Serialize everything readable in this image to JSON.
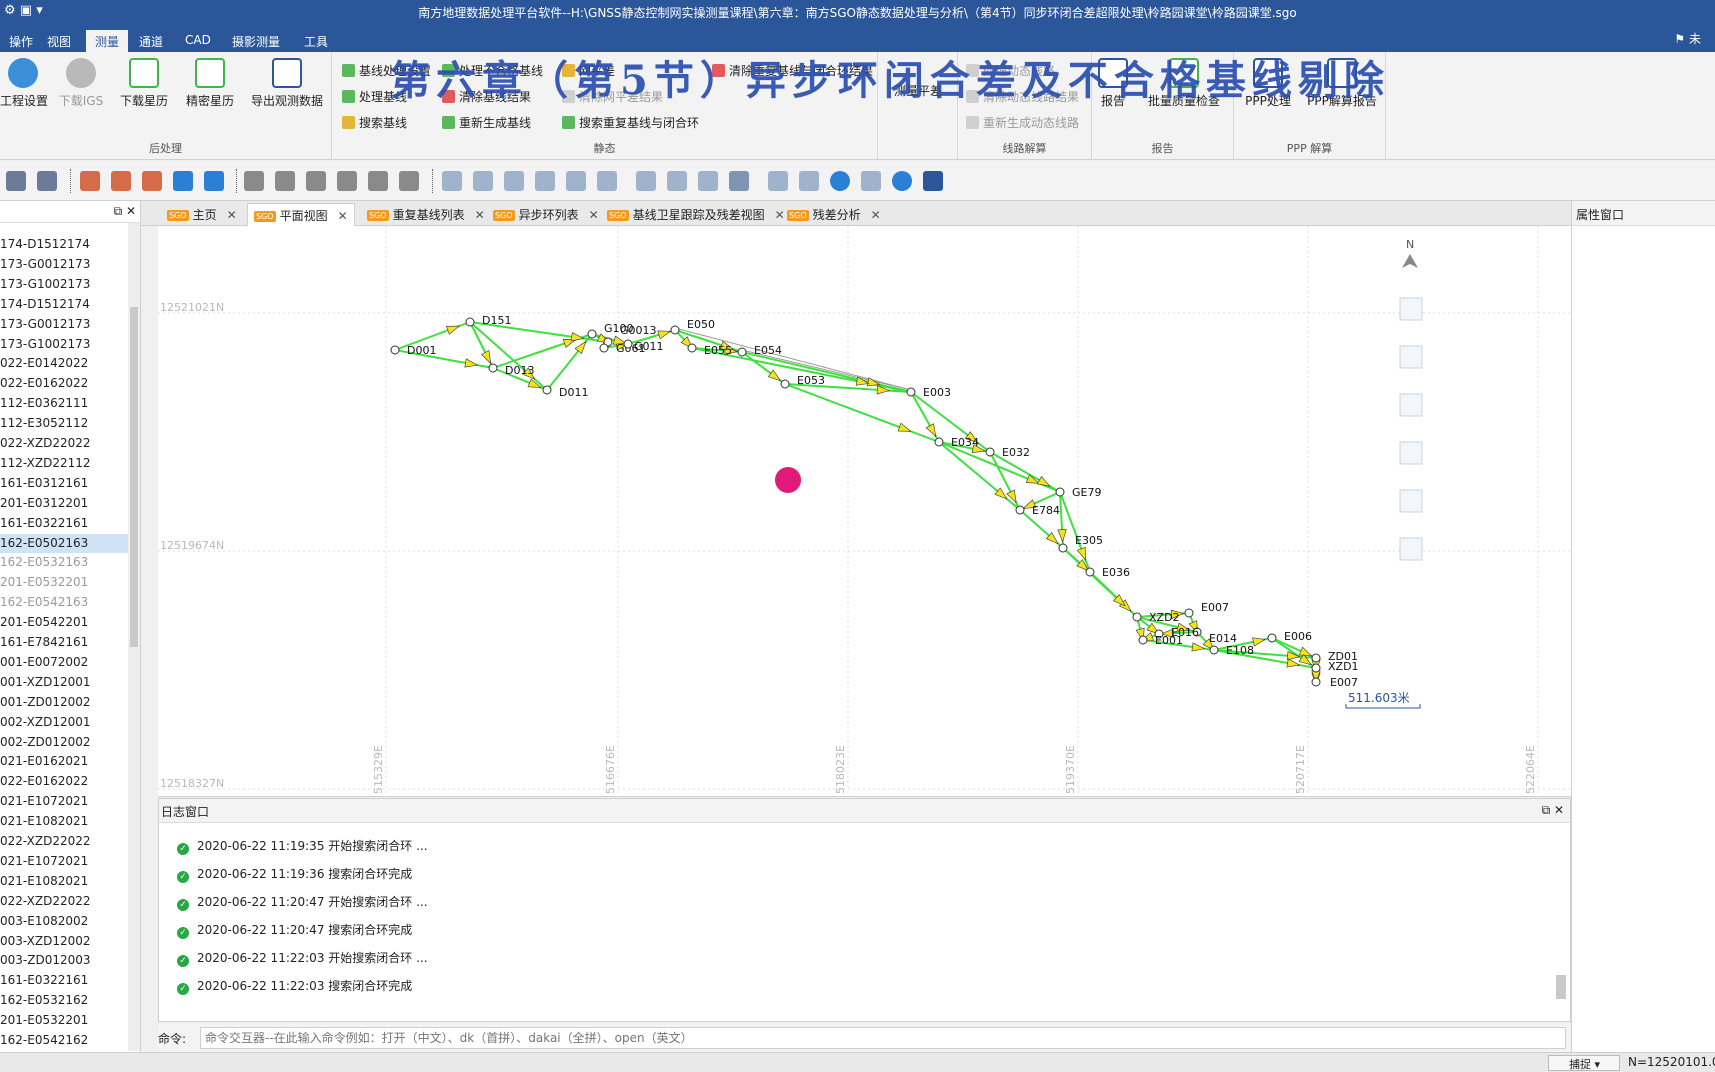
{
  "titlebar": {
    "title": "南方地理数据处理平台软件--H:\\GNSS静态控制网实操测量课程\\第六章：南方SGO静态数据处理与分析\\（第4节）同步环闭合差超限处理\\柃路园课堂\\柃路园课堂.sgo",
    "quick_access": "⚙ ▣ ▾"
  },
  "ribbon_tabs": [
    {
      "label": "操作"
    },
    {
      "label": "视图"
    },
    {
      "label": "测量"
    },
    {
      "label": "通道"
    },
    {
      "label": "CAD"
    },
    {
      "label": "摄影测量"
    },
    {
      "label": "工具"
    }
  ],
  "user_label": "⚑ 未",
  "ribbon": {
    "post_group": {
      "label": "后处理",
      "buttons": [
        "工程设置",
        "下载IGS",
        "下载星历",
        "精密星历",
        "导出观测数据"
      ]
    },
    "static_group": {
      "label": "静态",
      "col1": [
        "基线处理设置",
        "处理基线",
        "搜索基线"
      ],
      "col2": [
        "处理不合格基线",
        "清除基线结果",
        "重新生成基线"
      ],
      "col3": [
        "网平差",
        "清除网平差结果",
        "搜索重复基线与闭合环"
      ],
      "col4": [
        "清除重复基线与闭合环结果"
      ]
    },
    "adjust_button": "测量平差",
    "route_group": {
      "label": "线路解算",
      "items": [
        "处理动态线路",
        "清除动态线路结果",
        "重新生成动态线路"
      ]
    },
    "report_group": {
      "label": "报告",
      "buttons": [
        "报告",
        "批量质量检查"
      ]
    },
    "ppp_group": {
      "label": "PPP 解算",
      "buttons": [
        "PPP处理",
        "PPP解算报告"
      ]
    }
  },
  "overlay_title": "第六章（第5节）异步环闭合差及不合格基线剔除",
  "left_panel": {
    "items": [
      "174-D1512174",
      "173-G0012173",
      "173-G1002173",
      "174-D1512174",
      "173-G0012173",
      "173-G1002173",
      "022-E0142022",
      "022-E0162022",
      "112-E0362111",
      "112-E3052112",
      "022-XZD22022",
      "112-XZD22112",
      "161-E0312161",
      "201-E0312201",
      "161-E0322161",
      "162-E0502163",
      "162-E0532163",
      "201-E0532201",
      "162-E0542163",
      "201-E0542201",
      "161-E7842161",
      "001-E0072002",
      "001-XZD12001",
      "001-ZD012002",
      "002-XZD12001",
      "002-ZD012002",
      "021-E0162021",
      "022-E0162022",
      "021-E1072021",
      "021-E1082021",
      "022-XZD22022",
      "021-E1072021",
      "021-E1082021",
      "022-XZD22022",
      "003-E1082002",
      "003-XZD12002",
      "003-ZD012003",
      "161-E0322161",
      "162-E0532162",
      "201-E0532201",
      "162-E0542162"
    ],
    "selected_index": 15,
    "dim_indices": [
      16,
      17,
      18
    ]
  },
  "doc_tabs": [
    {
      "label": "主页"
    },
    {
      "label": "平面视图"
    },
    {
      "label": "重复基线列表"
    },
    {
      "label": "异步环列表"
    },
    {
      "label": "基线卫星跟踪及残差视图"
    },
    {
      "label": "残差分析"
    }
  ],
  "right_panel": {
    "title": "属性窗口"
  },
  "map": {
    "grid_y_labels": [
      "12521021N",
      "12519674N",
      "12518327N"
    ],
    "grid_x_labels": [
      "515329E",
      "516676E",
      "518023E",
      "519370E",
      "520717E",
      "522064E"
    ],
    "scale_label": "511.603米",
    "north_label": "N",
    "points": [
      {
        "name": "D001"
      },
      {
        "name": "D151"
      },
      {
        "name": "D013"
      },
      {
        "name": "D011"
      },
      {
        "name": "G100"
      },
      {
        "name": "G0013"
      },
      {
        "name": "G061"
      },
      {
        "name": "G011"
      },
      {
        "name": "E050"
      },
      {
        "name": "E055"
      },
      {
        "name": "E054"
      },
      {
        "name": "E053"
      },
      {
        "name": "E003"
      },
      {
        "name": "E034"
      },
      {
        "name": "E032"
      },
      {
        "name": "GE79"
      },
      {
        "name": "E784"
      },
      {
        "name": "E305"
      },
      {
        "name": "E036"
      },
      {
        "name": "XZD2"
      },
      {
        "name": "E007"
      },
      {
        "name": "E014"
      },
      {
        "name": "E016"
      },
      {
        "name": "E001"
      },
      {
        "name": "E108"
      },
      {
        "name": "E006"
      },
      {
        "name": "ZD01"
      },
      {
        "name": "XZD1"
      },
      {
        "name": "E007"
      }
    ]
  },
  "log": {
    "title": "日志窗口",
    "lines": [
      "2020-06-22 11:19:35  开始搜索闭合环 ...",
      "2020-06-22 11:19:36  搜索闭合环完成",
      "2020-06-22 11:20:47  开始搜索闭合环 ...",
      "2020-06-22 11:20:47  搜索闭合环完成",
      "2020-06-22 11:22:03  开始搜索闭合环 ...",
      "2020-06-22 11:22:03  搜索闭合环完成"
    ]
  },
  "command": {
    "label": "命令:",
    "placeholder": "命令交互器--在此输入命令例如：打开（中文）、dk（首拼）、dakai（全拼）、open（英文）"
  },
  "status": {
    "snap_label": "捕捉",
    "coord": "N=12520101.0"
  },
  "colors": {
    "titlebar": "#2b579a",
    "baseline": "#3ee03e",
    "arrow": "#f5e21f",
    "marker": "#e0197a"
  }
}
